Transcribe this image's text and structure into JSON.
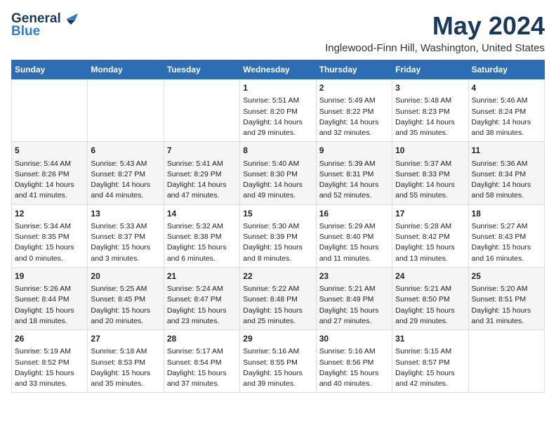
{
  "logo": {
    "line1": "General",
    "line2": "Blue"
  },
  "title": "May 2024",
  "subtitle": "Inglewood-Finn Hill, Washington, United States",
  "days": [
    "Sunday",
    "Monday",
    "Tuesday",
    "Wednesday",
    "Thursday",
    "Friday",
    "Saturday"
  ],
  "weeks": [
    [
      {
        "day": "",
        "info": ""
      },
      {
        "day": "",
        "info": ""
      },
      {
        "day": "",
        "info": ""
      },
      {
        "day": "1",
        "info": "Sunrise: 5:51 AM\nSunset: 8:20 PM\nDaylight: 14 hours and 29 minutes."
      },
      {
        "day": "2",
        "info": "Sunrise: 5:49 AM\nSunset: 8:22 PM\nDaylight: 14 hours and 32 minutes."
      },
      {
        "day": "3",
        "info": "Sunrise: 5:48 AM\nSunset: 8:23 PM\nDaylight: 14 hours and 35 minutes."
      },
      {
        "day": "4",
        "info": "Sunrise: 5:46 AM\nSunset: 8:24 PM\nDaylight: 14 hours and 38 minutes."
      }
    ],
    [
      {
        "day": "5",
        "info": "Sunrise: 5:44 AM\nSunset: 8:26 PM\nDaylight: 14 hours and 41 minutes."
      },
      {
        "day": "6",
        "info": "Sunrise: 5:43 AM\nSunset: 8:27 PM\nDaylight: 14 hours and 44 minutes."
      },
      {
        "day": "7",
        "info": "Sunrise: 5:41 AM\nSunset: 8:29 PM\nDaylight: 14 hours and 47 minutes."
      },
      {
        "day": "8",
        "info": "Sunrise: 5:40 AM\nSunset: 8:30 PM\nDaylight: 14 hours and 49 minutes."
      },
      {
        "day": "9",
        "info": "Sunrise: 5:39 AM\nSunset: 8:31 PM\nDaylight: 14 hours and 52 minutes."
      },
      {
        "day": "10",
        "info": "Sunrise: 5:37 AM\nSunset: 8:33 PM\nDaylight: 14 hours and 55 minutes."
      },
      {
        "day": "11",
        "info": "Sunrise: 5:36 AM\nSunset: 8:34 PM\nDaylight: 14 hours and 58 minutes."
      }
    ],
    [
      {
        "day": "12",
        "info": "Sunrise: 5:34 AM\nSunset: 8:35 PM\nDaylight: 15 hours and 0 minutes."
      },
      {
        "day": "13",
        "info": "Sunrise: 5:33 AM\nSunset: 8:37 PM\nDaylight: 15 hours and 3 minutes."
      },
      {
        "day": "14",
        "info": "Sunrise: 5:32 AM\nSunset: 8:38 PM\nDaylight: 15 hours and 6 minutes."
      },
      {
        "day": "15",
        "info": "Sunrise: 5:30 AM\nSunset: 8:39 PM\nDaylight: 15 hours and 8 minutes."
      },
      {
        "day": "16",
        "info": "Sunrise: 5:29 AM\nSunset: 8:40 PM\nDaylight: 15 hours and 11 minutes."
      },
      {
        "day": "17",
        "info": "Sunrise: 5:28 AM\nSunset: 8:42 PM\nDaylight: 15 hours and 13 minutes."
      },
      {
        "day": "18",
        "info": "Sunrise: 5:27 AM\nSunset: 8:43 PM\nDaylight: 15 hours and 16 minutes."
      }
    ],
    [
      {
        "day": "19",
        "info": "Sunrise: 5:26 AM\nSunset: 8:44 PM\nDaylight: 15 hours and 18 minutes."
      },
      {
        "day": "20",
        "info": "Sunrise: 5:25 AM\nSunset: 8:45 PM\nDaylight: 15 hours and 20 minutes."
      },
      {
        "day": "21",
        "info": "Sunrise: 5:24 AM\nSunset: 8:47 PM\nDaylight: 15 hours and 23 minutes."
      },
      {
        "day": "22",
        "info": "Sunrise: 5:22 AM\nSunset: 8:48 PM\nDaylight: 15 hours and 25 minutes."
      },
      {
        "day": "23",
        "info": "Sunrise: 5:21 AM\nSunset: 8:49 PM\nDaylight: 15 hours and 27 minutes."
      },
      {
        "day": "24",
        "info": "Sunrise: 5:21 AM\nSunset: 8:50 PM\nDaylight: 15 hours and 29 minutes."
      },
      {
        "day": "25",
        "info": "Sunrise: 5:20 AM\nSunset: 8:51 PM\nDaylight: 15 hours and 31 minutes."
      }
    ],
    [
      {
        "day": "26",
        "info": "Sunrise: 5:19 AM\nSunset: 8:52 PM\nDaylight: 15 hours and 33 minutes."
      },
      {
        "day": "27",
        "info": "Sunrise: 5:18 AM\nSunset: 8:53 PM\nDaylight: 15 hours and 35 minutes."
      },
      {
        "day": "28",
        "info": "Sunrise: 5:17 AM\nSunset: 8:54 PM\nDaylight: 15 hours and 37 minutes."
      },
      {
        "day": "29",
        "info": "Sunrise: 5:16 AM\nSunset: 8:55 PM\nDaylight: 15 hours and 39 minutes."
      },
      {
        "day": "30",
        "info": "Sunrise: 5:16 AM\nSunset: 8:56 PM\nDaylight: 15 hours and 40 minutes."
      },
      {
        "day": "31",
        "info": "Sunrise: 5:15 AM\nSunset: 8:57 PM\nDaylight: 15 hours and 42 minutes."
      },
      {
        "day": "",
        "info": ""
      }
    ]
  ]
}
